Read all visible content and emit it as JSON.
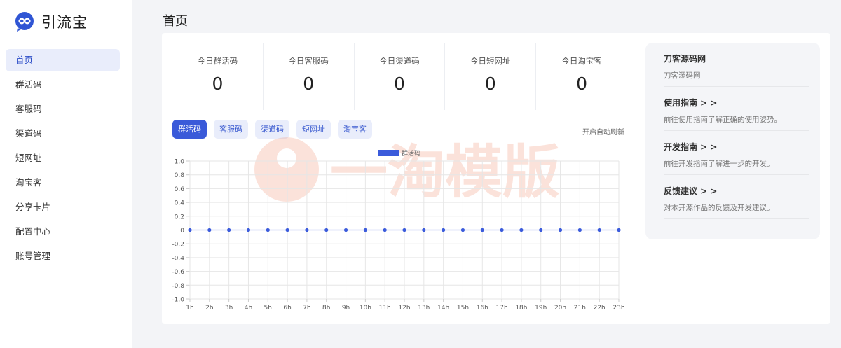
{
  "app": {
    "name": "引流宝",
    "logo_icon": "infinity-chat-icon"
  },
  "sidebar": {
    "items": [
      {
        "label": "首页",
        "active": true
      },
      {
        "label": "群活码"
      },
      {
        "label": "客服码"
      },
      {
        "label": "渠道码"
      },
      {
        "label": "短网址"
      },
      {
        "label": "淘宝客"
      },
      {
        "label": "分享卡片"
      },
      {
        "label": "配置中心"
      },
      {
        "label": "账号管理"
      }
    ]
  },
  "page": {
    "title": "首页"
  },
  "stats": [
    {
      "label": "今日群活码",
      "value": "0"
    },
    {
      "label": "今日客服码",
      "value": "0"
    },
    {
      "label": "今日渠道码",
      "value": "0"
    },
    {
      "label": "今日短网址",
      "value": "0"
    },
    {
      "label": "今日淘宝客",
      "value": "0"
    }
  ],
  "tabs": [
    {
      "label": "群活码",
      "active": true
    },
    {
      "label": "客服码"
    },
    {
      "label": "渠道码"
    },
    {
      "label": "短网址"
    },
    {
      "label": "淘宝客"
    }
  ],
  "auto_refresh_label": "开启自动刷新",
  "watermark_text": "一淘模版",
  "chart_data": {
    "type": "line",
    "x": [
      "1h",
      "2h",
      "3h",
      "4h",
      "5h",
      "6h",
      "7h",
      "8h",
      "9h",
      "10h",
      "11h",
      "12h",
      "13h",
      "14h",
      "15h",
      "16h",
      "17h",
      "18h",
      "19h",
      "20h",
      "21h",
      "22h",
      "23h"
    ],
    "series": [
      {
        "name": "群活码",
        "values": [
          0,
          0,
          0,
          0,
          0,
          0,
          0,
          0,
          0,
          0,
          0,
          0,
          0,
          0,
          0,
          0,
          0,
          0,
          0,
          0,
          0,
          0,
          0
        ],
        "color": "#3b5bdb"
      }
    ],
    "yticks": [
      "1.0",
      "0.8",
      "0.6",
      "0.4",
      "0.2",
      "0",
      "-0.2",
      "-0.4",
      "-0.6",
      "-0.8",
      "-1.0"
    ],
    "ylim": [
      -1,
      1
    ],
    "grid": true,
    "legend": "top-center"
  },
  "side_links": [
    {
      "title": "刀客源码网",
      "desc": "刀客源码网"
    },
    {
      "title": "使用指南 > >",
      "desc": "前往使用指南了解正确的使用姿势。"
    },
    {
      "title": "开发指南 > >",
      "desc": "前往开发指南了解进一步的开发。"
    },
    {
      "title": "反馈建议 > >",
      "desc": "对本开源作品的反馈及开发建议。"
    }
  ],
  "colors": {
    "accent": "#3a5ad9",
    "tab_bg": "#e9edfb",
    "active_nav_bg": "#e9edfb"
  }
}
